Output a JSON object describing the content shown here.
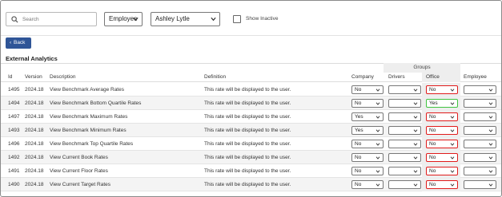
{
  "search": {
    "placeholder": "Search"
  },
  "filters": {
    "type_value": "Employee",
    "user_value": "Ashley Lytle",
    "show_inactive_label": "Show Inactive"
  },
  "back_button": {
    "label": "Back"
  },
  "section_title": "External Analytics",
  "groups_header": "Groups",
  "columns": {
    "id": "Id",
    "version": "Version",
    "description": "Description",
    "definition": "Definition",
    "company": "Company",
    "drivers": "Drivers",
    "office": "Office",
    "employee": "Employee"
  },
  "rows": [
    {
      "id": "1495",
      "version": "2024.18",
      "description": "View Benchmark Average Rates",
      "definition": "This rate will be displayed to the user.",
      "company": "No",
      "drivers": "",
      "office": "No",
      "office_state": "red",
      "employee": ""
    },
    {
      "id": "1494",
      "version": "2024.18",
      "description": "View Benchmark Bottom Quartile Rates",
      "definition": "This rate will be displayed to the user.",
      "company": "No",
      "drivers": "",
      "office": "Yes",
      "office_state": "green",
      "employee": ""
    },
    {
      "id": "1497",
      "version": "2024.18",
      "description": "View Benchmark Maximum Rates",
      "definition": "This rate will be displayed to the user.",
      "company": "Yes",
      "drivers": "",
      "office": "No",
      "office_state": "red",
      "employee": ""
    },
    {
      "id": "1493",
      "version": "2024.18",
      "description": "View Benchmark Minimum Rates",
      "definition": "This rate will be displayed to the user.",
      "company": "Yes",
      "drivers": "",
      "office": "No",
      "office_state": "red",
      "employee": ""
    },
    {
      "id": "1496",
      "version": "2024.18",
      "description": "View Benchmark Top Quartile Rates",
      "definition": "This rate will be displayed to the user.",
      "company": "No",
      "drivers": "",
      "office": "No",
      "office_state": "red",
      "employee": ""
    },
    {
      "id": "1492",
      "version": "2024.18",
      "description": "View Current Book Rates",
      "definition": "This rate will be displayed to the user.",
      "company": "No",
      "drivers": "",
      "office": "No",
      "office_state": "red",
      "employee": ""
    },
    {
      "id": "1491",
      "version": "2024.18",
      "description": "View Current Floor Rates",
      "definition": "This rate will be displayed to the user.",
      "company": "No",
      "drivers": "",
      "office": "No",
      "office_state": "red",
      "employee": ""
    },
    {
      "id": "1490",
      "version": "2024.18",
      "description": "View Current Target Rates",
      "definition": "This rate will be displayed to the user.",
      "company": "No",
      "drivers": "",
      "office": "No",
      "office_state": "red",
      "employee": ""
    }
  ],
  "colors": {
    "back_button": "#2f5597",
    "invalid_border": "#e01b1b",
    "valid_border": "#3fc33f",
    "groups_header_bg": "#eeeeee"
  },
  "icons": {
    "search": "search-icon",
    "dropdown": "chevron-down-icon",
    "back": "chevron-left-icon"
  }
}
